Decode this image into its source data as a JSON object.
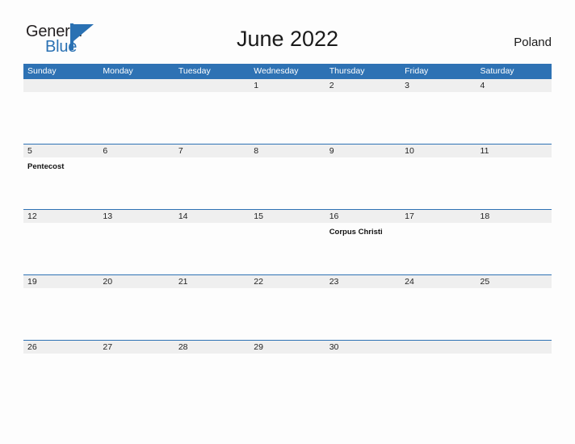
{
  "brand": {
    "name_part1": "General",
    "name_part2": "Blue",
    "accent_color": "#2a71b3"
  },
  "header": {
    "title": "June 2022",
    "region": "Poland"
  },
  "calendar": {
    "header_color": "#2e72b4",
    "band_color": "#efefef",
    "weekdays": [
      "Sunday",
      "Monday",
      "Tuesday",
      "Wednesday",
      "Thursday",
      "Friday",
      "Saturday"
    ],
    "weeks": [
      [
        {
          "day": ""
        },
        {
          "day": ""
        },
        {
          "day": ""
        },
        {
          "day": "1"
        },
        {
          "day": "2"
        },
        {
          "day": "3"
        },
        {
          "day": "4"
        }
      ],
      [
        {
          "day": "5",
          "event": "Pentecost"
        },
        {
          "day": "6"
        },
        {
          "day": "7"
        },
        {
          "day": "8"
        },
        {
          "day": "9"
        },
        {
          "day": "10"
        },
        {
          "day": "11"
        }
      ],
      [
        {
          "day": "12"
        },
        {
          "day": "13"
        },
        {
          "day": "14"
        },
        {
          "day": "15"
        },
        {
          "day": "16",
          "event": "Corpus Christi"
        },
        {
          "day": "17"
        },
        {
          "day": "18"
        }
      ],
      [
        {
          "day": "19"
        },
        {
          "day": "20"
        },
        {
          "day": "21"
        },
        {
          "day": "22"
        },
        {
          "day": "23"
        },
        {
          "day": "24"
        },
        {
          "day": "25"
        }
      ],
      [
        {
          "day": "26"
        },
        {
          "day": "27"
        },
        {
          "day": "28"
        },
        {
          "day": "29"
        },
        {
          "day": "30"
        },
        {
          "day": ""
        },
        {
          "day": ""
        }
      ]
    ]
  }
}
